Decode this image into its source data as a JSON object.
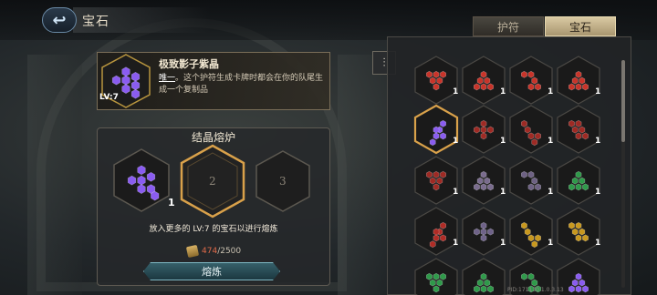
{
  "header": {
    "title": "宝石",
    "back_icon": "back-arrow-icon"
  },
  "tabs": [
    {
      "label": "护符",
      "active": false
    },
    {
      "label": "宝石",
      "active": true
    }
  ],
  "selected_gem": {
    "name": "极致影子紫晶",
    "level": "LV:7",
    "desc_keyword": "唯一",
    "desc_rest": "。这个护符生成卡牌时都会在你的队尾生成一个复制品",
    "color": "#8a5cf0"
  },
  "furnace": {
    "title": "结晶熔炉",
    "slot1_count": "1",
    "slot2_label": "2",
    "slot3_label": "3",
    "hint": "放入更多的 LV:7 的宝石以进行熔炼",
    "cost_have": "474",
    "cost_sep": "/",
    "cost_need": "2500",
    "smelt_label": "熔炼"
  },
  "inventory": {
    "items": [
      {
        "color": "#c8342a",
        "count": "1",
        "selected": false
      },
      {
        "color": "#c8342a",
        "count": "1",
        "selected": false
      },
      {
        "color": "#c8342a",
        "count": "1",
        "selected": false
      },
      {
        "color": "#c8342a",
        "count": "1",
        "selected": false
      },
      {
        "color": "#8a5cf0",
        "count": "1",
        "selected": true
      },
      {
        "color": "#9e2a24",
        "count": "1",
        "selected": false
      },
      {
        "color": "#9e2a24",
        "count": "1",
        "selected": false
      },
      {
        "color": "#9e2a24",
        "count": "1",
        "selected": false
      },
      {
        "color": "#9e2a24",
        "count": "1",
        "selected": false
      },
      {
        "color": "#7a6c8e",
        "count": "1",
        "selected": false
      },
      {
        "color": "#6e6284",
        "count": "1",
        "selected": false
      },
      {
        "color": "#2f9a4a",
        "count": "1",
        "selected": false
      },
      {
        "color": "#b02c26",
        "count": "1",
        "selected": false
      },
      {
        "color": "#6e6288",
        "count": "1",
        "selected": false
      },
      {
        "color": "#c8981e",
        "count": "1",
        "selected": false
      },
      {
        "color": "#c8981e",
        "count": "1",
        "selected": false
      },
      {
        "color": "#2f9a4a",
        "count": "",
        "selected": false
      },
      {
        "color": "#2f9a4a",
        "count": "",
        "selected": false
      },
      {
        "color": "#2f9a4a",
        "count": "",
        "selected": false
      },
      {
        "color": "#8a5cf0",
        "count": "",
        "selected": false
      }
    ],
    "version": "PID:171130 1.0.3.13"
  }
}
